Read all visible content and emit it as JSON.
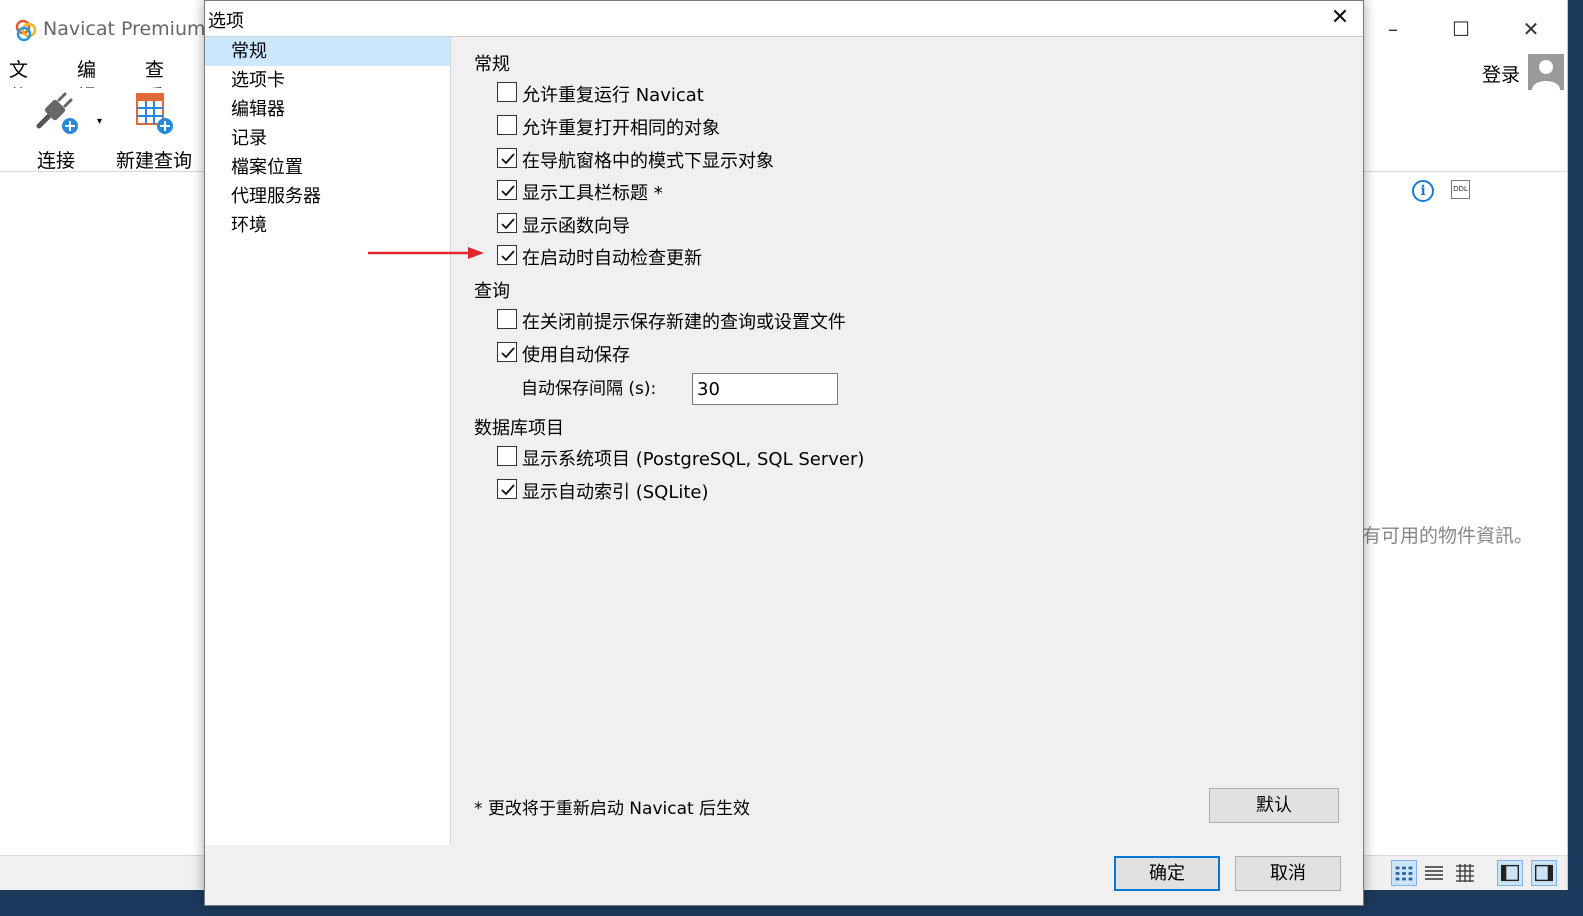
{
  "main": {
    "app_title": "Navicat Premium",
    "menu": [
      "文件",
      "编辑",
      "查看"
    ],
    "toolbar": {
      "connect_label": "连接",
      "new_query_label": "新建查询"
    },
    "login_label": "登录",
    "no_info_text": "有可用的物件資訊。",
    "icons": {
      "info": "info-icon",
      "ddl": "ddl-icon"
    }
  },
  "dialog": {
    "title": "选项",
    "nav": [
      "常规",
      "选项卡",
      "编辑器",
      "记录",
      "檔案位置",
      "代理服务器",
      "环境"
    ],
    "selected_nav": "常规",
    "sections": {
      "general": {
        "title": "常规",
        "options": [
          {
            "label": "允许重复运行 Navicat",
            "checked": false
          },
          {
            "label": "允许重复打开相同的对象",
            "checked": false
          },
          {
            "label": "在导航窗格中的模式下显示对象",
            "checked": true
          },
          {
            "label": "显示工具栏标题 *",
            "checked": true
          },
          {
            "label": "显示函数向导",
            "checked": true
          },
          {
            "label": "在启动时自动检查更新",
            "checked": true
          }
        ]
      },
      "query": {
        "title": "查询",
        "options": [
          {
            "label": "在关闭前提示保存新建的查询或设置文件",
            "checked": false
          },
          {
            "label": "使用自动保存",
            "checked": true
          }
        ],
        "autosave_interval_label": "自动保存间隔 (s):",
        "autosave_interval_value": "30"
      },
      "database": {
        "title": "数据库项目",
        "options": [
          {
            "label": "显示系统项目 (PostgreSQL, SQL Server)",
            "checked": false
          },
          {
            "label": "显示自动索引 (SQLite)",
            "checked": true
          }
        ]
      }
    },
    "restart_note": "* 更改将于重新启动 Navicat 后生效",
    "buttons": {
      "default": "默认",
      "ok": "确定",
      "cancel": "取消"
    }
  },
  "colors": {
    "annotation_arrow": "#e0262b",
    "selected_nav_bg": "#cce8ff",
    "accent": "#0078d7"
  }
}
